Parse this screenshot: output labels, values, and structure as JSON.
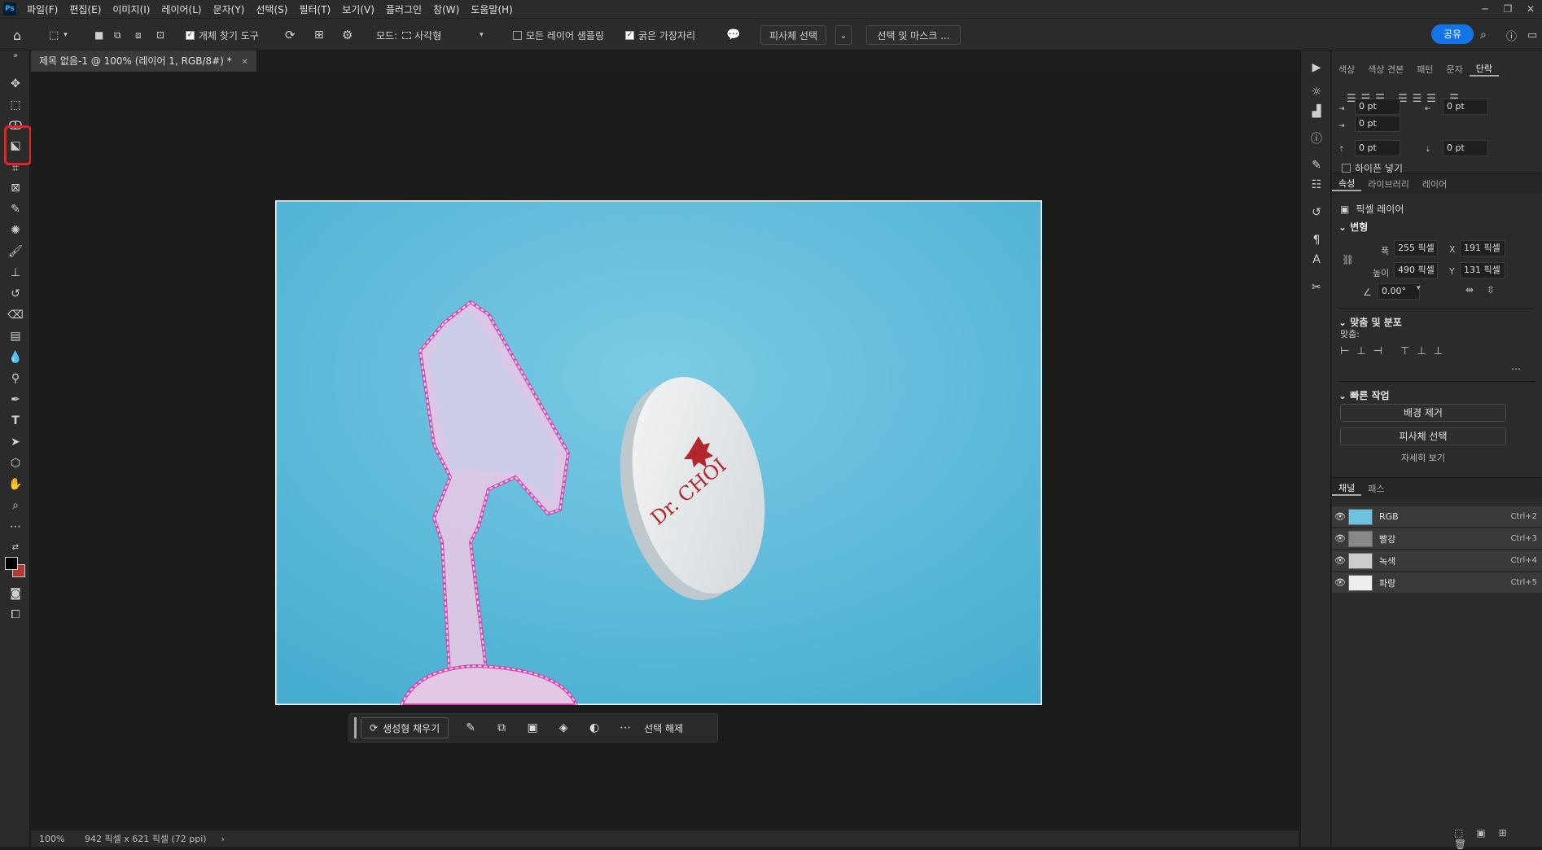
{
  "menu": [
    "파일(F)",
    "편집(E)",
    "이미지(I)",
    "레이어(L)",
    "문자(Y)",
    "선택(S)",
    "필터(T)",
    "보기(V)",
    "플러그인",
    "창(W)",
    "도움말(H)"
  ],
  "options": {
    "object_finder_label": "개체 찾기 도구",
    "mode_label": "모드:",
    "mode_value": "사각형",
    "sample_all_label": "모든 레이어 샘플링",
    "hard_edge_label": "굵은 가장자리",
    "select_subject_label": "피사체 선택",
    "select_mask_label": "선택 및 마스크 ...",
    "share_label": "공유"
  },
  "document": {
    "tab_title": "제목 없음-1 @ 100% (레이어 1, RGB/8#) *",
    "zoom": "100%",
    "info": "942 픽셀 x 621 픽셀 (72 ppi)",
    "image_text": "Dr. CHOI"
  },
  "context_bar": {
    "gen_fill_label": "생성형 채우기",
    "deselect_label": "선택 해제"
  },
  "panel": {
    "top_tabs": [
      "색상",
      "색상 견본",
      "패턴",
      "문자",
      "단락"
    ],
    "pt_values": [
      "0 pt",
      "0 pt",
      "0 pt",
      "0 pt",
      "0 pt"
    ],
    "hyphen_label": "하이픈 넣기",
    "props_tabs": [
      "속성",
      "라이브러리",
      "레이어"
    ],
    "pixel_layer_label": "픽셀 레이어",
    "transform_title": "변형",
    "width_label": "폭",
    "width_value": "255 픽셀",
    "x_label": "X",
    "x_value": "191 픽셀",
    "height_label": "높이",
    "height_value": "490 픽셀",
    "y_label": "Y",
    "y_value": "131 픽셀",
    "angle_value": "0.00°",
    "align_title": "맞춤 및 분포",
    "align_label": "맞춤:",
    "quick_title": "빠른 작업",
    "remove_bg_label": "배경 제거",
    "select_subject_label": "피사체 선택",
    "more_label": "자세히 보기",
    "channel_tabs": [
      "채널",
      "패스"
    ],
    "channels": [
      {
        "name": "RGB",
        "key": "Ctrl+2"
      },
      {
        "name": "빨강",
        "key": "Ctrl+3"
      },
      {
        "name": "녹색",
        "key": "Ctrl+4"
      },
      {
        "name": "파랑",
        "key": "Ctrl+5"
      }
    ]
  },
  "colors": {
    "accent": "#1473e6",
    "selection": "#e040b0",
    "canvas_bg": "#5bbcd9",
    "highlight": "#e8202a"
  }
}
